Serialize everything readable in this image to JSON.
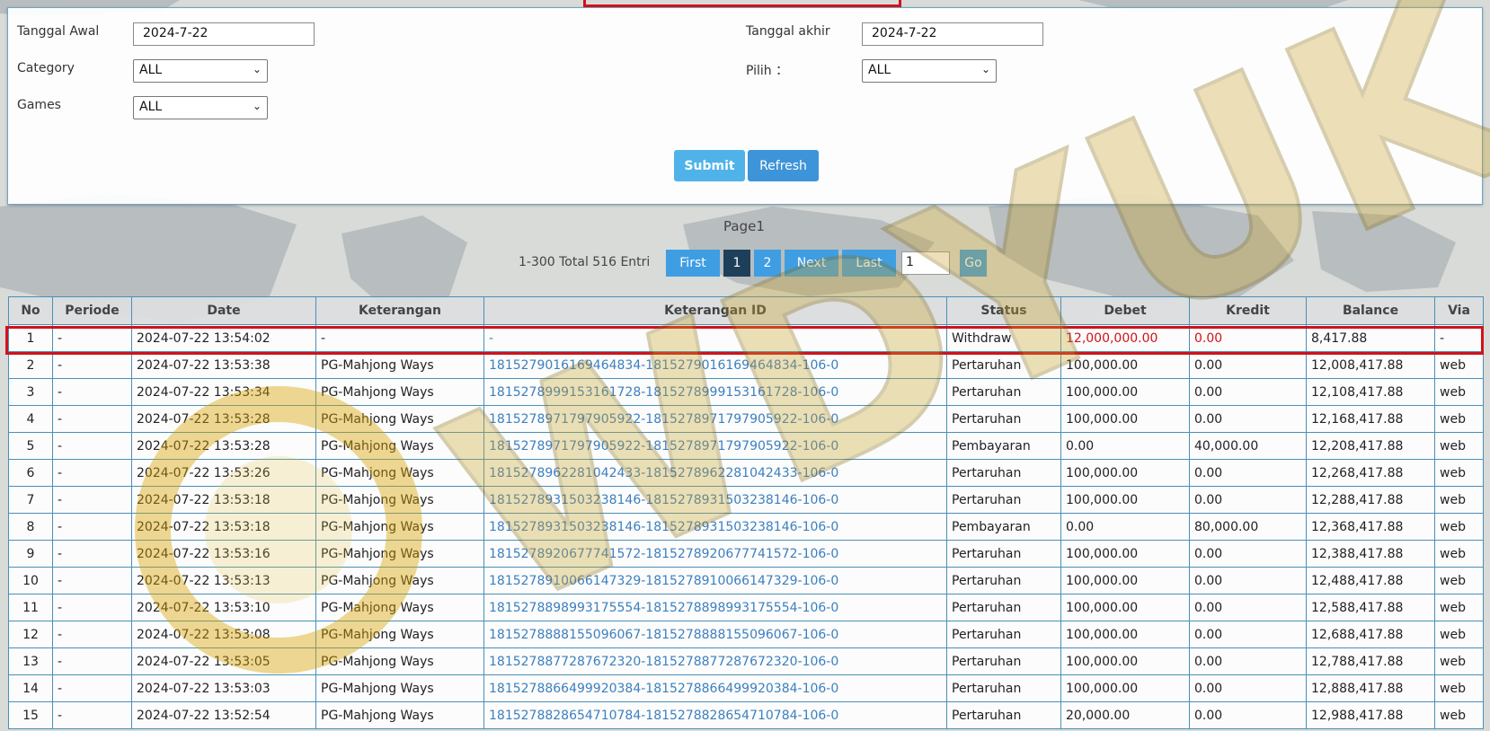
{
  "filters": {
    "tanggal_awal_label": "Tanggal Awal",
    "tanggal_awal_value": "2024-7-22",
    "tanggal_akhir_label": "Tanggal akhir",
    "tanggal_akhir_value": "2024-7-22",
    "category_label": "Category",
    "category_value": "ALL",
    "pilih_label": "Pilih ：",
    "pilih_value": "ALL",
    "games_label": "Games",
    "games_value": "ALL",
    "submit_label": "Submit",
    "refresh_label": "Refresh"
  },
  "pagination": {
    "page_title": "Page1",
    "summary": "1-300 Total 516 Entri",
    "first": "First",
    "page1": "1",
    "page2": "2",
    "next": "Next",
    "last": "Last",
    "page_input": "1",
    "go": "Go"
  },
  "table": {
    "headers": [
      "No",
      "Periode",
      "Date",
      "Keterangan",
      "Keterangan ID",
      "Status",
      "Debet",
      "Kredit",
      "Balance",
      "Via"
    ],
    "rows": [
      [
        "1",
        "-",
        "2024-07-22 13:54:02",
        "-",
        "-",
        "Withdraw",
        "12,000,000.00",
        "0.00",
        "8,417.88",
        "-"
      ],
      [
        "2",
        "-",
        "2024-07-22 13:53:38",
        "PG-Mahjong Ways",
        "1815279016169464834-1815279016169464834-106-0",
        "Pertaruhan",
        "100,000.00",
        "0.00",
        "12,008,417.88",
        "web"
      ],
      [
        "3",
        "-",
        "2024-07-22 13:53:34",
        "PG-Mahjong Ways",
        "1815278999153161728-1815278999153161728-106-0",
        "Pertaruhan",
        "100,000.00",
        "0.00",
        "12,108,417.88",
        "web"
      ],
      [
        "4",
        "-",
        "2024-07-22 13:53:28",
        "PG-Mahjong Ways",
        "1815278971797905922-1815278971797905922-106-0",
        "Pertaruhan",
        "100,000.00",
        "0.00",
        "12,168,417.88",
        "web"
      ],
      [
        "5",
        "-",
        "2024-07-22 13:53:28",
        "PG-Mahjong Ways",
        "1815278971797905922-1815278971797905922-106-0",
        "Pembayaran",
        "0.00",
        "40,000.00",
        "12,208,417.88",
        "web"
      ],
      [
        "6",
        "-",
        "2024-07-22 13:53:26",
        "PG-Mahjong Ways",
        "1815278962281042433-1815278962281042433-106-0",
        "Pertaruhan",
        "100,000.00",
        "0.00",
        "12,268,417.88",
        "web"
      ],
      [
        "7",
        "-",
        "2024-07-22 13:53:18",
        "PG-Mahjong Ways",
        "1815278931503238146-1815278931503238146-106-0",
        "Pertaruhan",
        "100,000.00",
        "0.00",
        "12,288,417.88",
        "web"
      ],
      [
        "8",
        "-",
        "2024-07-22 13:53:18",
        "PG-Mahjong Ways",
        "1815278931503238146-1815278931503238146-106-0",
        "Pembayaran",
        "0.00",
        "80,000.00",
        "12,368,417.88",
        "web"
      ],
      [
        "9",
        "-",
        "2024-07-22 13:53:16",
        "PG-Mahjong Ways",
        "1815278920677741572-1815278920677741572-106-0",
        "Pertaruhan",
        "100,000.00",
        "0.00",
        "12,388,417.88",
        "web"
      ],
      [
        "10",
        "-",
        "2024-07-22 13:53:13",
        "PG-Mahjong Ways",
        "1815278910066147329-1815278910066147329-106-0",
        "Pertaruhan",
        "100,000.00",
        "0.00",
        "12,488,417.88",
        "web"
      ],
      [
        "11",
        "-",
        "2024-07-22 13:53:10",
        "PG-Mahjong Ways",
        "1815278898993175554-1815278898993175554-106-0",
        "Pertaruhan",
        "100,000.00",
        "0.00",
        "12,588,417.88",
        "web"
      ],
      [
        "12",
        "-",
        "2024-07-22 13:53:08",
        "PG-Mahjong Ways",
        "1815278888155096067-1815278888155096067-106-0",
        "Pertaruhan",
        "100,000.00",
        "0.00",
        "12,688,417.88",
        "web"
      ],
      [
        "13",
        "-",
        "2024-07-22 13:53:05",
        "PG-Mahjong Ways",
        "1815278877287672320-1815278877287672320-106-0",
        "Pertaruhan",
        "100,000.00",
        "0.00",
        "12,788,417.88",
        "web"
      ],
      [
        "14",
        "-",
        "2024-07-22 13:53:03",
        "PG-Mahjong Ways",
        "1815278866499920384-1815278866499920384-106-0",
        "Pertaruhan",
        "100,000.00",
        "0.00",
        "12,888,417.88",
        "web"
      ],
      [
        "15",
        "-",
        "2024-07-22 13:52:54",
        "PG-Mahjong Ways",
        "1815278828654710784-1815278828654710784-106-0",
        "Pertaruhan",
        "20,000.00",
        "0.00",
        "12,988,417.88",
        "web"
      ]
    ]
  },
  "watermark_text": "WDYUK",
  "colors": {
    "accent_blue": "#3f9ee2",
    "highlight_red": "#d0121b",
    "link_blue": "#3d7fc0",
    "watermark_gold": "#d9a300"
  }
}
